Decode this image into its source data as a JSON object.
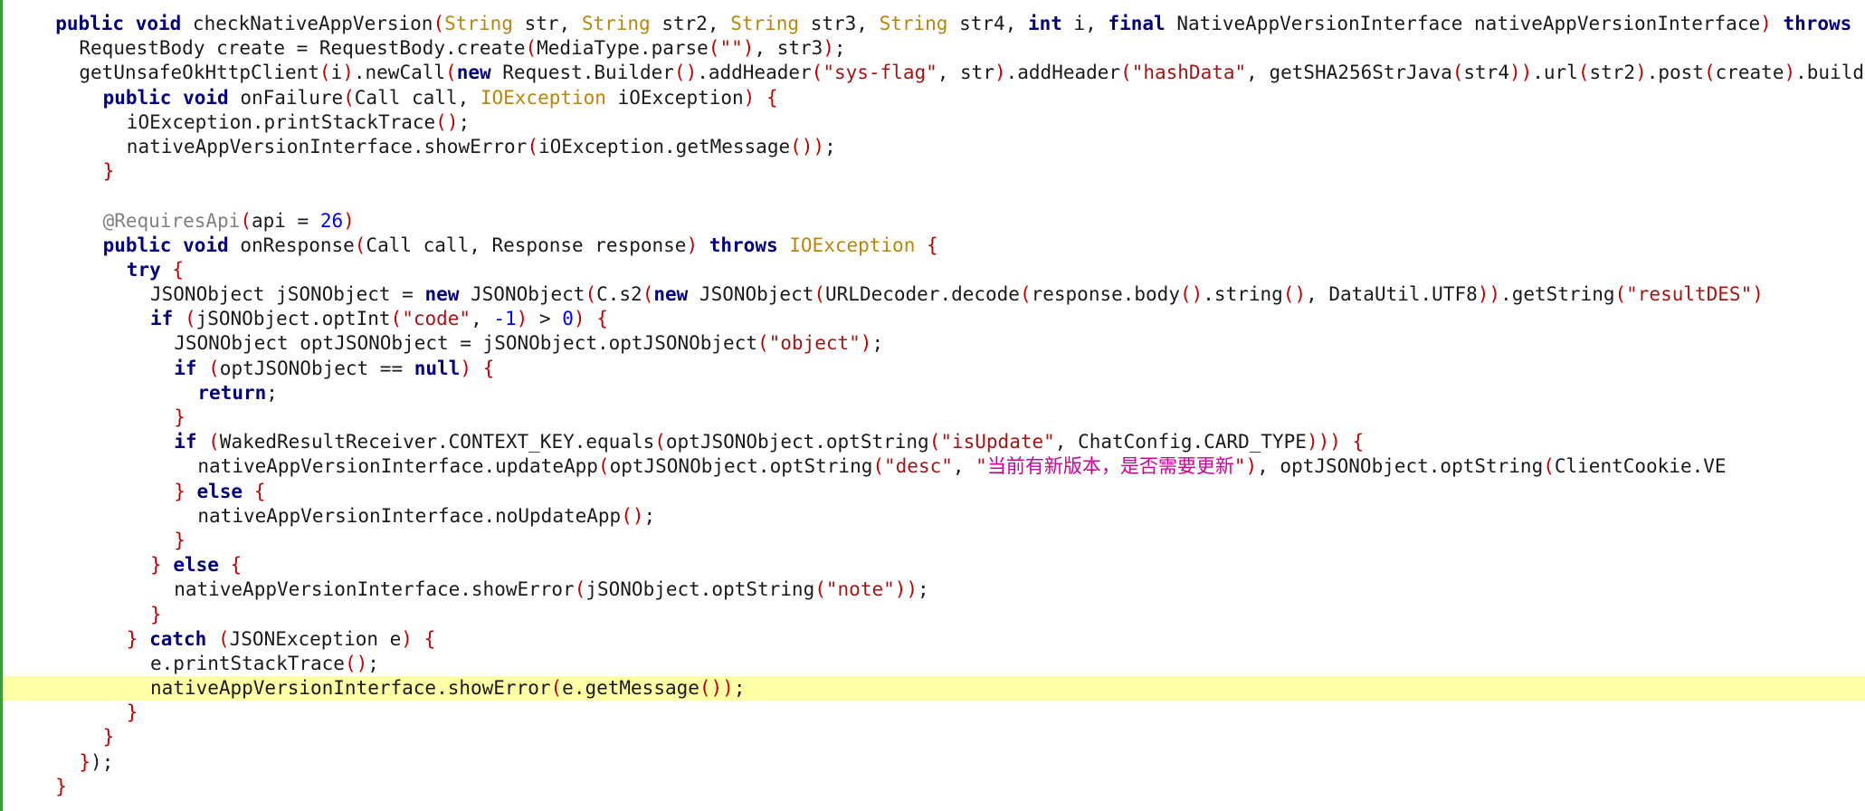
{
  "editor": {
    "highlight_line_index": 27,
    "colors": {
      "keyword": "#000080",
      "type": "#b8860b",
      "string": "#a31515",
      "cjk_string": "#cc0099",
      "number": "#0000ff",
      "annotation": "#808080",
      "bracket": "#c00000",
      "highlight": "#ffffa6",
      "gutter_border": "#3c9a3c"
    },
    "lines": [
      {
        "indent": "  ",
        "tokens": [
          [
            "kw",
            "public"
          ],
          [
            "p",
            " "
          ],
          [
            "kw",
            "void"
          ],
          [
            "p",
            " checkNativeAppVersion"
          ],
          [
            "br",
            "("
          ],
          [
            "type",
            "String"
          ],
          [
            "p",
            " str, "
          ],
          [
            "type",
            "String"
          ],
          [
            "p",
            " str2, "
          ],
          [
            "type",
            "String"
          ],
          [
            "p",
            " str3, "
          ],
          [
            "type",
            "String"
          ],
          [
            "p",
            " str4, "
          ],
          [
            "kw",
            "int"
          ],
          [
            "p",
            " i, "
          ],
          [
            "kw",
            "final"
          ],
          [
            "p",
            " NativeAppVersionInterface nativeAppVersionInterface"
          ],
          [
            "br",
            ")"
          ],
          [
            "p",
            " "
          ],
          [
            "kw",
            "throws"
          ]
        ]
      },
      {
        "indent": "    ",
        "tokens": [
          [
            "p",
            "RequestBody create = RequestBody.create"
          ],
          [
            "br",
            "("
          ],
          [
            "p",
            "MediaType.parse"
          ],
          [
            "br",
            "("
          ],
          [
            "str",
            "\"\""
          ],
          [
            "br",
            ")"
          ],
          [
            "p",
            ", str3"
          ],
          [
            "br",
            ")"
          ],
          [
            "p",
            ";"
          ]
        ]
      },
      {
        "indent": "    ",
        "tokens": [
          [
            "p",
            "getUnsafeOkHttpClient"
          ],
          [
            "br",
            "("
          ],
          [
            "p",
            "i"
          ],
          [
            "br",
            ")"
          ],
          [
            "p",
            ".newCall"
          ],
          [
            "br",
            "("
          ],
          [
            "kw",
            "new"
          ],
          [
            "p",
            " Request.Builder"
          ],
          [
            "br",
            "()"
          ],
          [
            "p",
            ".addHeader"
          ],
          [
            "br",
            "("
          ],
          [
            "str",
            "\"sys-flag\""
          ],
          [
            "p",
            ", str"
          ],
          [
            "br",
            ")"
          ],
          [
            "p",
            ".addHeader"
          ],
          [
            "br",
            "("
          ],
          [
            "str",
            "\"hashData\""
          ],
          [
            "p",
            ", getSHA256StrJava"
          ],
          [
            "br",
            "("
          ],
          [
            "p",
            "str4"
          ],
          [
            "br",
            "))"
          ],
          [
            "p",
            ".url"
          ],
          [
            "br",
            "("
          ],
          [
            "p",
            "str2"
          ],
          [
            "br",
            ")"
          ],
          [
            "p",
            ".post"
          ],
          [
            "br",
            "("
          ],
          [
            "p",
            "create"
          ],
          [
            "br",
            ")"
          ],
          [
            "p",
            ".build"
          ]
        ]
      },
      {
        "indent": "      ",
        "tokens": [
          [
            "kw",
            "public"
          ],
          [
            "p",
            " "
          ],
          [
            "kw",
            "void"
          ],
          [
            "p",
            " onFailure"
          ],
          [
            "br",
            "("
          ],
          [
            "p",
            "Call call, "
          ],
          [
            "type",
            "IOException"
          ],
          [
            "p",
            " iOException"
          ],
          [
            "br",
            ")"
          ],
          [
            "p",
            " "
          ],
          [
            "br",
            "{"
          ]
        ]
      },
      {
        "indent": "        ",
        "tokens": [
          [
            "p",
            "iOException.printStackTrace"
          ],
          [
            "br",
            "()"
          ],
          [
            "p",
            ";"
          ]
        ]
      },
      {
        "indent": "        ",
        "tokens": [
          [
            "p",
            "nativeAppVersionInterface.showError"
          ],
          [
            "br",
            "("
          ],
          [
            "p",
            "iOException.getMessage"
          ],
          [
            "br",
            "())"
          ],
          [
            "p",
            ";"
          ]
        ]
      },
      {
        "indent": "      ",
        "tokens": [
          [
            "br",
            "}"
          ]
        ]
      },
      {
        "indent": "",
        "tokens": []
      },
      {
        "indent": "      ",
        "tokens": [
          [
            "anno",
            "@RequiresApi"
          ],
          [
            "br",
            "("
          ],
          [
            "p",
            "api = "
          ],
          [
            "num",
            "26"
          ],
          [
            "br",
            ")"
          ]
        ]
      },
      {
        "indent": "      ",
        "tokens": [
          [
            "kw",
            "public"
          ],
          [
            "p",
            " "
          ],
          [
            "kw",
            "void"
          ],
          [
            "p",
            " onResponse"
          ],
          [
            "br",
            "("
          ],
          [
            "p",
            "Call call, Response response"
          ],
          [
            "br",
            ")"
          ],
          [
            "p",
            " "
          ],
          [
            "kw",
            "throws"
          ],
          [
            "p",
            " "
          ],
          [
            "type",
            "IOException"
          ],
          [
            "p",
            " "
          ],
          [
            "br",
            "{"
          ]
        ]
      },
      {
        "indent": "        ",
        "tokens": [
          [
            "kw",
            "try"
          ],
          [
            "p",
            " "
          ],
          [
            "br",
            "{"
          ]
        ]
      },
      {
        "indent": "          ",
        "tokens": [
          [
            "p",
            "JSONObject jSONObject = "
          ],
          [
            "kw",
            "new"
          ],
          [
            "p",
            " JSONObject"
          ],
          [
            "br",
            "("
          ],
          [
            "p",
            "C.s2"
          ],
          [
            "br",
            "("
          ],
          [
            "kw",
            "new"
          ],
          [
            "p",
            " JSONObject"
          ],
          [
            "br",
            "("
          ],
          [
            "p",
            "URLDecoder.decode"
          ],
          [
            "br",
            "("
          ],
          [
            "p",
            "response.body"
          ],
          [
            "br",
            "()"
          ],
          [
            "p",
            ".string"
          ],
          [
            "br",
            "()"
          ],
          [
            "p",
            ", DataUtil.UTF8"
          ],
          [
            "br",
            "))"
          ],
          [
            "p",
            ".getString"
          ],
          [
            "br",
            "("
          ],
          [
            "str",
            "\"resultDES\""
          ],
          [
            "br",
            ")"
          ]
        ]
      },
      {
        "indent": "          ",
        "tokens": [
          [
            "kw",
            "if"
          ],
          [
            "p",
            " "
          ],
          [
            "br",
            "("
          ],
          [
            "p",
            "jSONObject.optInt"
          ],
          [
            "br",
            "("
          ],
          [
            "str",
            "\"code\""
          ],
          [
            "p",
            ", "
          ],
          [
            "num",
            "-1"
          ],
          [
            "br",
            ")"
          ],
          [
            "p",
            " > "
          ],
          [
            "num",
            "0"
          ],
          [
            "br",
            ")"
          ],
          [
            "p",
            " "
          ],
          [
            "br",
            "{"
          ]
        ]
      },
      {
        "indent": "            ",
        "tokens": [
          [
            "p",
            "JSONObject optJSONObject = jSONObject.optJSONObject"
          ],
          [
            "br",
            "("
          ],
          [
            "str",
            "\"object\""
          ],
          [
            "br",
            ")"
          ],
          [
            "p",
            ";"
          ]
        ]
      },
      {
        "indent": "            ",
        "tokens": [
          [
            "kw",
            "if"
          ],
          [
            "p",
            " "
          ],
          [
            "br",
            "("
          ],
          [
            "p",
            "optJSONObject == "
          ],
          [
            "kw",
            "null"
          ],
          [
            "br",
            ")"
          ],
          [
            "p",
            " "
          ],
          [
            "br",
            "{"
          ]
        ]
      },
      {
        "indent": "              ",
        "tokens": [
          [
            "kw",
            "return"
          ],
          [
            "p",
            ";"
          ]
        ]
      },
      {
        "indent": "            ",
        "tokens": [
          [
            "br",
            "}"
          ]
        ]
      },
      {
        "indent": "            ",
        "tokens": [
          [
            "kw",
            "if"
          ],
          [
            "p",
            " "
          ],
          [
            "br",
            "("
          ],
          [
            "p",
            "WakedResultReceiver.CONTEXT_KEY.equals"
          ],
          [
            "br",
            "("
          ],
          [
            "p",
            "optJSONObject.optString"
          ],
          [
            "br",
            "("
          ],
          [
            "str",
            "\"isUpdate\""
          ],
          [
            "p",
            ", ChatConfig.CARD_TYPE"
          ],
          [
            "br",
            ")))"
          ],
          [
            "p",
            " "
          ],
          [
            "br",
            "{"
          ]
        ]
      },
      {
        "indent": "              ",
        "tokens": [
          [
            "p",
            "nativeAppVersionInterface.updateApp"
          ],
          [
            "br",
            "("
          ],
          [
            "p",
            "optJSONObject.optString"
          ],
          [
            "br",
            "("
          ],
          [
            "str",
            "\"desc\""
          ],
          [
            "p",
            ", "
          ],
          [
            "str",
            "\""
          ],
          [
            "cjk",
            "当前有新版本，是否需要更新"
          ],
          [
            "str",
            "\""
          ],
          [
            "br",
            ")"
          ],
          [
            "p",
            ", optJSONObject.optString"
          ],
          [
            "br",
            "("
          ],
          [
            "p",
            "ClientCookie.VE"
          ]
        ]
      },
      {
        "indent": "            ",
        "tokens": [
          [
            "br",
            "}"
          ],
          [
            "p",
            " "
          ],
          [
            "kw",
            "else"
          ],
          [
            "p",
            " "
          ],
          [
            "br",
            "{"
          ]
        ]
      },
      {
        "indent": "              ",
        "tokens": [
          [
            "p",
            "nativeAppVersionInterface.noUpdateApp"
          ],
          [
            "br",
            "()"
          ],
          [
            "p",
            ";"
          ]
        ]
      },
      {
        "indent": "            ",
        "tokens": [
          [
            "br",
            "}"
          ]
        ]
      },
      {
        "indent": "          ",
        "tokens": [
          [
            "br",
            "}"
          ],
          [
            "p",
            " "
          ],
          [
            "kw",
            "else"
          ],
          [
            "p",
            " "
          ],
          [
            "br",
            "{"
          ]
        ]
      },
      {
        "indent": "            ",
        "tokens": [
          [
            "p",
            "nativeAppVersionInterface.showError"
          ],
          [
            "br",
            "("
          ],
          [
            "p",
            "jSONObject.optString"
          ],
          [
            "br",
            "("
          ],
          [
            "str",
            "\"note\""
          ],
          [
            "br",
            "))"
          ],
          [
            "p",
            ";"
          ]
        ]
      },
      {
        "indent": "          ",
        "tokens": [
          [
            "br",
            "}"
          ]
        ]
      },
      {
        "indent": "        ",
        "tokens": [
          [
            "br",
            "}"
          ],
          [
            "p",
            " "
          ],
          [
            "kw",
            "catch"
          ],
          [
            "p",
            " "
          ],
          [
            "br",
            "("
          ],
          [
            "p",
            "JSONException e"
          ],
          [
            "br",
            ")"
          ],
          [
            "p",
            " "
          ],
          [
            "br",
            "{"
          ]
        ]
      },
      {
        "indent": "          ",
        "tokens": [
          [
            "p",
            "e.printStackTrace"
          ],
          [
            "br",
            "()"
          ],
          [
            "p",
            ";"
          ]
        ]
      },
      {
        "indent": "          ",
        "tokens": [
          [
            "p",
            "nativeAppVersionInterface.showError"
          ],
          [
            "br",
            "("
          ],
          [
            "p",
            "e.getMessage"
          ],
          [
            "br",
            "())"
          ],
          [
            "p",
            ";"
          ]
        ]
      },
      {
        "indent": "        ",
        "tokens": [
          [
            "br",
            "}"
          ]
        ]
      },
      {
        "indent": "      ",
        "tokens": [
          [
            "br",
            "}"
          ]
        ]
      },
      {
        "indent": "    ",
        "tokens": [
          [
            "br",
            "}"
          ],
          [
            "p",
            ")"
          ],
          [
            "p",
            ";"
          ]
        ]
      },
      {
        "indent": "  ",
        "tokens": [
          [
            "br",
            "}"
          ]
        ]
      }
    ]
  }
}
